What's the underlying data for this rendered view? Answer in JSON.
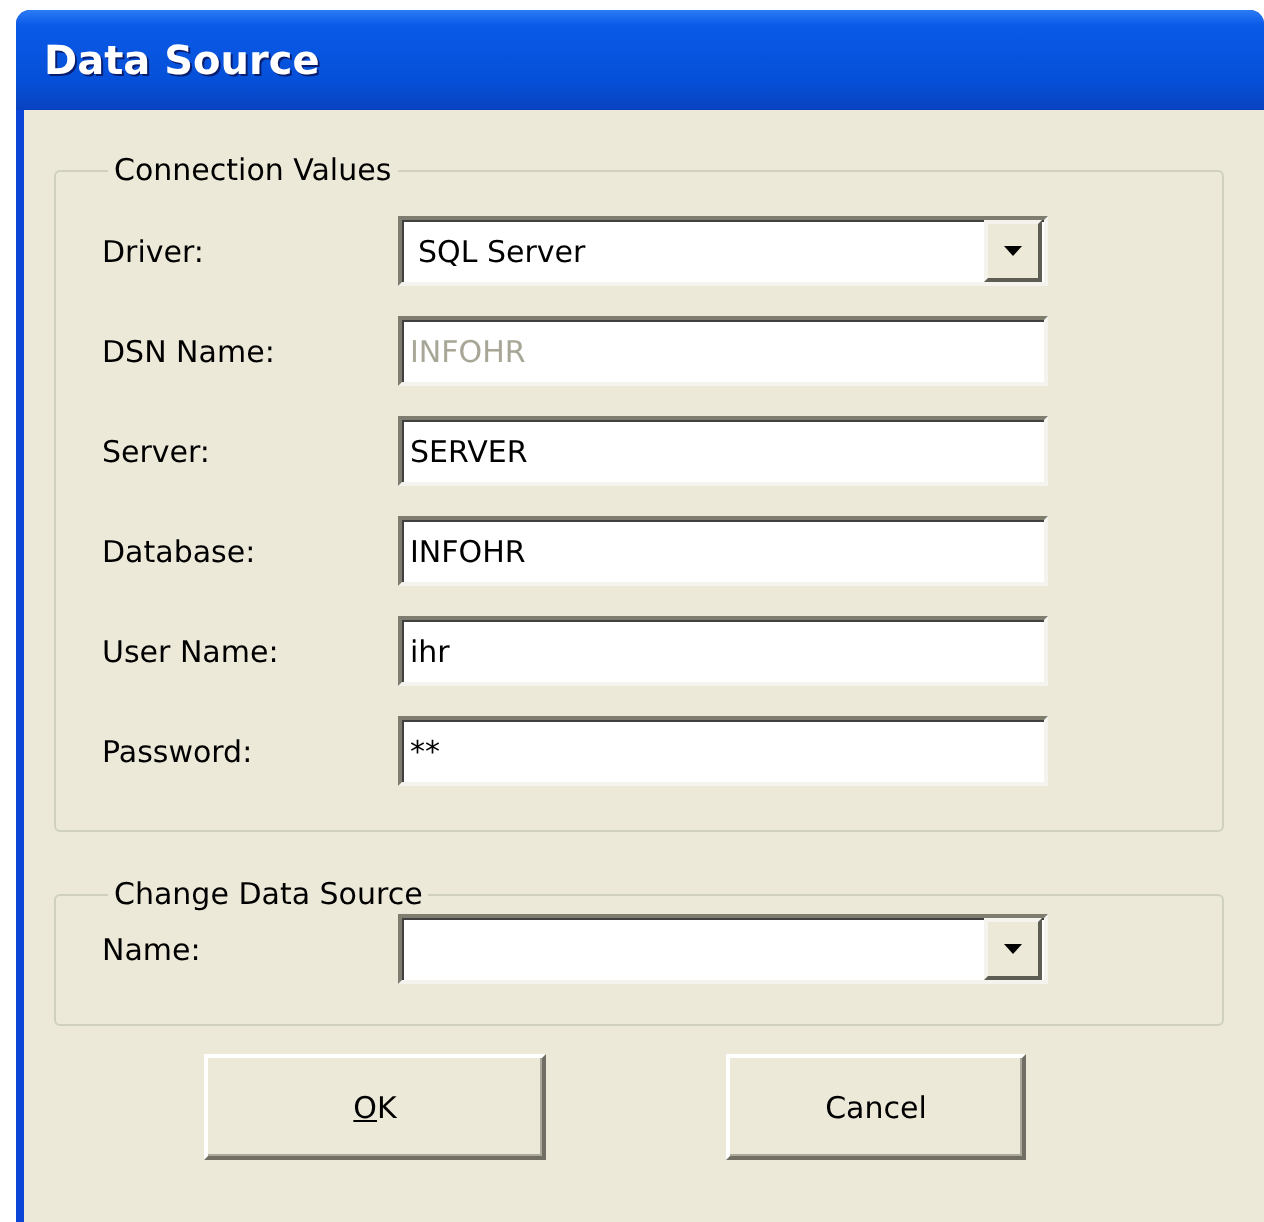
{
  "window": {
    "title": "Data Source"
  },
  "groups": [
    {
      "title": "Connection Values",
      "fields": [
        {
          "label": "Driver:",
          "kind": "combo",
          "value": "SQL Server",
          "disabled": false
        },
        {
          "label": "DSN Name:",
          "kind": "text",
          "value": "INFOHR",
          "disabled": true
        },
        {
          "label": "Server:",
          "kind": "text",
          "value": "SERVER",
          "disabled": false
        },
        {
          "label": "Database:",
          "kind": "text",
          "value": "INFOHR",
          "disabled": false
        },
        {
          "label": "User Name:",
          "kind": "text",
          "value": "ihr",
          "disabled": false
        },
        {
          "label": "Password:",
          "kind": "text",
          "value": "**",
          "disabled": false
        }
      ]
    },
    {
      "title": "Change Data Source",
      "fields": [
        {
          "label": "Name:",
          "kind": "combo",
          "disabled": false
        }
      ]
    }
  ],
  "buttons": [
    {
      "label": "OK",
      "first_letter_underlined": true
    },
    {
      "label": "Cancel"
    }
  ]
}
